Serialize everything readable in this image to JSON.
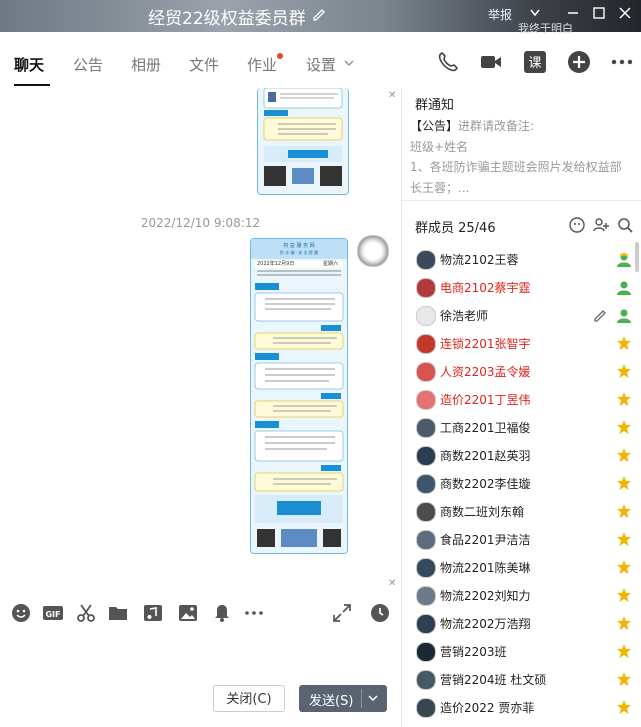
{
  "window": {
    "title": "经贸22级权益委员群",
    "report_label": "举报",
    "bg_text": "我终于明白"
  },
  "tabs": [
    {
      "label": "聊天"
    },
    {
      "label": "公告"
    },
    {
      "label": "相册"
    },
    {
      "label": "文件"
    },
    {
      "label": "作业"
    },
    {
      "label": "设置"
    }
  ],
  "toolbar_icons": [
    "phone-icon",
    "video-icon",
    "lesson-icon",
    "add-icon",
    "more-icon"
  ],
  "chat": {
    "timestamp": "2022/12/10 9:08:12",
    "poster_header": "2022年12月9日",
    "poster_side": "星期六"
  },
  "compose": {
    "close_label": "关闭(C)",
    "send_label": "发送(S)"
  },
  "notice": {
    "title": "群通知",
    "line1_tag": "【公告】",
    "line1_text": "进群请改备注:",
    "line2": "班级+姓名",
    "line3": "1、各班防诈骗主题班会照片发给权益部",
    "line4": "长王蓉；..."
  },
  "members": {
    "title": "群成员 25/46",
    "list": [
      {
        "name": "物流2102王蓉",
        "red": false,
        "badge": "owner"
      },
      {
        "name": "电商2102蔡宇霆",
        "red": true,
        "badge": "admin"
      },
      {
        "name": "徐浩老师",
        "red": false,
        "badge": "admin",
        "editable": true
      },
      {
        "name": "连锁2201张智宇",
        "red": true,
        "badge": "star"
      },
      {
        "name": "人资2203孟令媛",
        "red": true,
        "badge": "star"
      },
      {
        "name": "造价2201丁昱伟",
        "red": true,
        "badge": "star"
      },
      {
        "name": "工商2201卫福俊",
        "red": false,
        "badge": "star"
      },
      {
        "name": "商数2201赵英羽",
        "red": false,
        "badge": "star"
      },
      {
        "name": "商数2202李佳璇",
        "red": false,
        "badge": "star"
      },
      {
        "name": "商数二班刘东翰",
        "red": false,
        "badge": "star"
      },
      {
        "name": "食品2201尹洁洁",
        "red": false,
        "badge": "star"
      },
      {
        "name": "物流2201陈美琳",
        "red": false,
        "badge": "star"
      },
      {
        "name": "物流2202刘知力",
        "red": false,
        "badge": "star"
      },
      {
        "name": "物流2202万浩翔",
        "red": false,
        "badge": "star"
      },
      {
        "name": "营销2203班",
        "red": false,
        "badge": "star"
      },
      {
        "name": "营销2204班 杜文硕",
        "red": false,
        "badge": "star"
      },
      {
        "name": "造价2022 贾亦菲",
        "red": false,
        "badge": "star"
      }
    ]
  },
  "colors": {
    "accent_red": "#e0241b",
    "star": "#f5b400",
    "send_button": "#5a6470"
  }
}
